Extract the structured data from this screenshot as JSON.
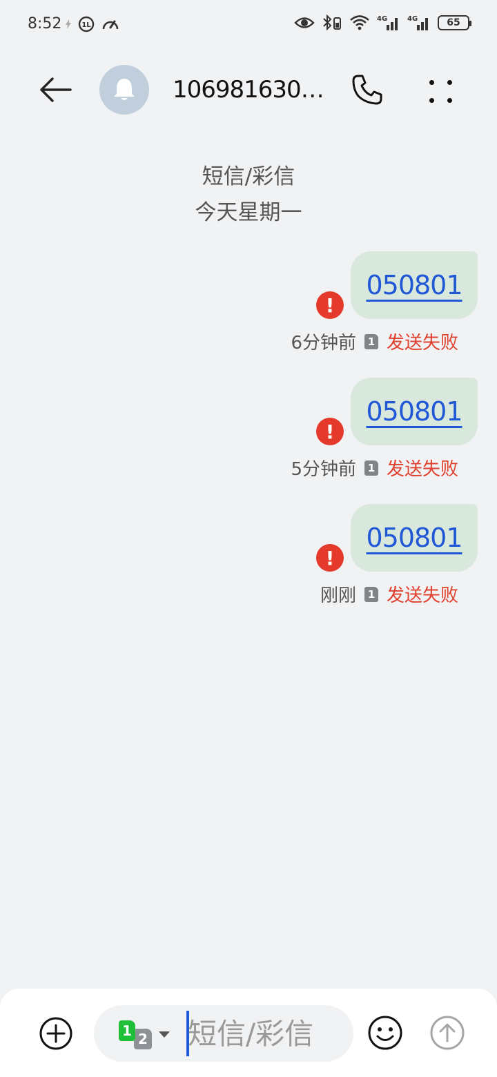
{
  "status_bar": {
    "time": "8:52",
    "battery": "65",
    "net1": "4G",
    "net2": "4G"
  },
  "header": {
    "contact": "1069816301···"
  },
  "conversation": {
    "type_label": "短信/彩信",
    "date_label": "今天星期一"
  },
  "messages": [
    {
      "text": "050801",
      "time": "6分钟前",
      "sim": "1",
      "status": "发送失败"
    },
    {
      "text": "050801",
      "time": "5分钟前",
      "sim": "1",
      "status": "发送失败"
    },
    {
      "text": "050801",
      "time": "刚刚",
      "sim": "1",
      "status": "发送失败"
    }
  ],
  "composer": {
    "placeholder": "短信/彩信",
    "sim_primary": "1",
    "sim_secondary": "2"
  },
  "icons": {
    "back": "arrow-left-icon",
    "avatar": "bell-icon",
    "call": "phone-icon",
    "more": "more-dots-icon",
    "error": "error-icon",
    "add": "plus-circle-icon",
    "emoji": "emoji-icon",
    "send": "send-arrow-icon"
  },
  "colors": {
    "background": "#f1f2f4",
    "bubble": "#d9e8dc",
    "link": "#1f57d6",
    "error": "#e53a2b"
  }
}
